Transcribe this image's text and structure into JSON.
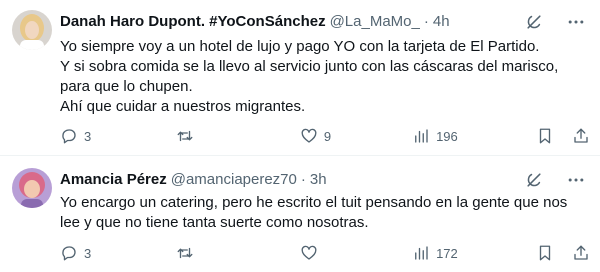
{
  "tweets": [
    {
      "author_name": "Danah Haro Dupont. #YoConSánchez",
      "handle": "@La_MaMo_",
      "separator": "·",
      "time": "4h",
      "lines": [
        "Yo siempre voy a un hotel de lujo y pago YO con la tarjeta de El Partido.",
        "Y si sobra comida se la llevo al servicio junto con las cáscaras del marisco,",
        "para que lo chupen.",
        "Ahí que cuidar a nuestros migrantes."
      ],
      "stats": {
        "replies": "3",
        "retweets": "",
        "likes": "9",
        "views": "196"
      },
      "avatar_colors": {
        "bg": "#d8d4cf",
        "hair": "#e8c88a",
        "face": "#f1d7c0"
      }
    },
    {
      "author_name": "Amancia Pérez",
      "handle": "@amanciaperez70",
      "separator": "·",
      "time": "3h",
      "lines": [
        "Yo encargo un catering, pero he escrito el tuit pensando en la gente que nos",
        "lee y que no tiene tanta suerte como nosotras."
      ],
      "stats": {
        "replies": "3",
        "retweets": "",
        "likes": "",
        "views": "172"
      },
      "avatar_colors": {
        "bg": "#b89fd6",
        "hair": "#d96a8a",
        "face": "#f2c9b0"
      }
    }
  ],
  "icons": {
    "grok": "grok-icon",
    "more": "more-icon",
    "reply": "reply-icon",
    "retweet": "retweet-icon",
    "like": "like-icon",
    "views": "views-icon",
    "bookmark": "bookmark-icon",
    "share": "share-icon"
  },
  "colors": {
    "text": "#0f1419",
    "secondary": "#536471",
    "divider": "#eff3f4"
  }
}
